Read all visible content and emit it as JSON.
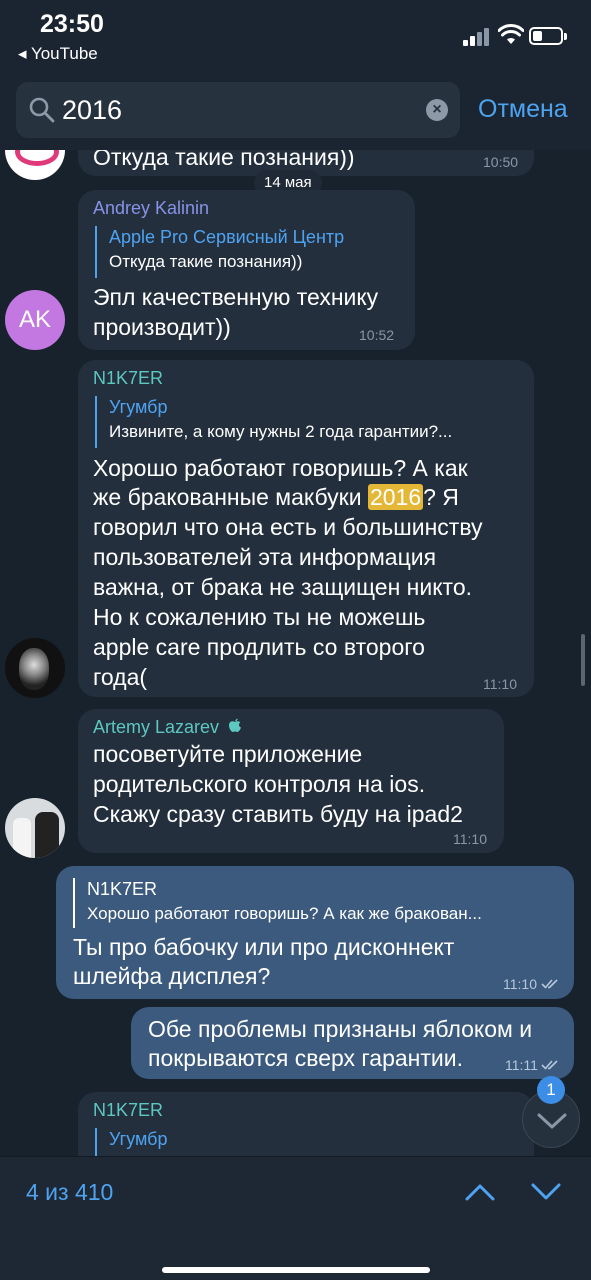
{
  "status_bar": {
    "time": "23:50",
    "back_app": "◂ YouTube"
  },
  "search": {
    "query": "2016",
    "cancel_label": "Отмена"
  },
  "chat": {
    "top_partial": {
      "text": "Откуда такие познания))",
      "time": "10:50"
    },
    "date_separator": "14 мая",
    "messages": [
      {
        "sender": "Andrey Kalinin",
        "sender_color": "#8793e6",
        "avatar_initials": "AK",
        "avatar_color": "#c278e0",
        "reply_name": "Apple Pro Сервисный Центр",
        "reply_text": "Откуда такие познания))",
        "line1": "Эпл качественную технику",
        "line2": "производит))",
        "time": "10:52"
      },
      {
        "sender": "N1K7ER",
        "sender_color": "#5cc8c0",
        "reply_name": "Угумбр",
        "reply_text": "Извините, а кому нужны 2 года гарантии?...",
        "line1": "Хорошо работают говоришь? А как",
        "line2_before": "же бракованные макбуки ",
        "line2_highlight": "2016",
        "line2_after": "? Я",
        "line3": "говорил что она есть и большинству",
        "line4": "пользователей эта информация",
        "line5": "важна, от брака не защищен никто.",
        "line6": "Но к сожалению ты не можешь",
        "line7": "apple care продлить со второго",
        "line8": "года(",
        "time": "11:10"
      },
      {
        "sender": "Artemy Lazarev",
        "sender_color": "#5cc8c0",
        "line1": "посоветуйте приложение",
        "line2": "родительского контроля на ios.",
        "line3": "Скажу сразу ставить буду на ipad2",
        "time": "11:10"
      },
      {
        "reply_name": "N1K7ER",
        "reply_text": "Хорошо работают говоришь? А как же бракован...",
        "line1": "Ты про бабочку или про дисконнект",
        "line2": "шлейфа дисплея?",
        "time": "11:10"
      },
      {
        "line1": "Обе проблемы признаны яблоком и",
        "line2": "покрываются сверх гарантии.",
        "time": "11:11"
      },
      {
        "sender": "N1K7ER",
        "reply_name": "Угумбр"
      }
    ],
    "unread_badge": "1"
  },
  "navigation": {
    "result_count": "4 из 410"
  },
  "colors": {
    "accent": "#4ea3f1",
    "background": "#18222d",
    "incoming_bubble": "#242f3d",
    "outgoing_bubble": "#3b5a7e",
    "highlight": "#e5b737"
  },
  "icons": [
    "search-icon",
    "clear-icon",
    "wifi-icon",
    "battery-icon",
    "signal-icon",
    "checkmark-icon",
    "chevron-up-icon",
    "chevron-down-icon",
    "apple-icon"
  ]
}
